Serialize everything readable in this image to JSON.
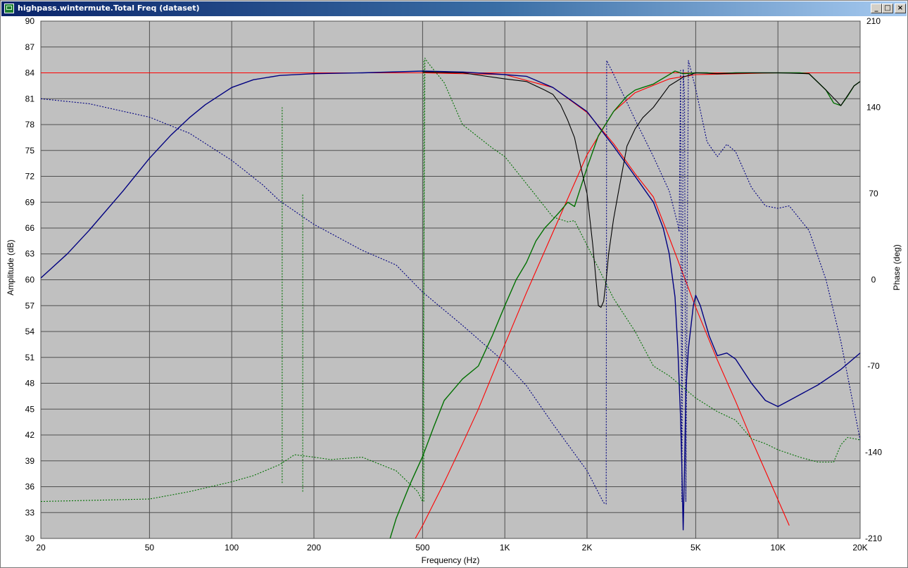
{
  "window": {
    "title": "highpass.wintermute.Total Freq (dataset)",
    "minimize_glyph": "_",
    "maximize_glyph": "□",
    "close_glyph": "×",
    "icon": "app-chart-icon"
  },
  "chart_data": {
    "type": "line",
    "xlabel": "Frequency (Hz)",
    "ylabel": "Amplitude (dB)",
    "y2label": "Phase (deg)",
    "xscale": "log",
    "xlim": [
      20,
      20000
    ],
    "ylim": [
      30,
      90
    ],
    "y2lim": [
      -210,
      210
    ],
    "grid": true,
    "x_ticks": [
      20,
      50,
      100,
      200,
      500,
      1000,
      2000,
      5000,
      10000,
      20000
    ],
    "x_tick_labels": [
      "20",
      "50",
      "100",
      "200",
      "500",
      "1K",
      "2K",
      "5K",
      "10K",
      "20K"
    ],
    "y_ticks": [
      30,
      33,
      36,
      39,
      42,
      45,
      48,
      51,
      54,
      57,
      60,
      63,
      66,
      69,
      72,
      75,
      78,
      81,
      84,
      87,
      90
    ],
    "y_tick_labels": [
      "30",
      "33",
      "36",
      "39",
      "42",
      "45",
      "48",
      "51",
      "54",
      "57",
      "60",
      "63",
      "66",
      "69",
      "72",
      "75",
      "78",
      "81",
      "84",
      "87",
      "90"
    ],
    "y2_ticks": [
      -210,
      -140,
      -70,
      0,
      70,
      140,
      210
    ],
    "y2_tick_labels": [
      "-210",
      "-140",
      "-70",
      "0",
      "70",
      "140",
      "210"
    ],
    "colors": {
      "plot_background": "#c0c0c0",
      "grid": "#505050",
      "target": "#ff0000",
      "woofer": "#000080",
      "tweeter": "#007000",
      "total": "#000000"
    },
    "series": [
      {
        "style": "red-solid",
        "color": "#ff0000",
        "axis": "left",
        "points": [
          [
            20,
            84
          ],
          [
            20000,
            84
          ]
        ]
      },
      {
        "style": "red-solid",
        "color": "#ff0000",
        "axis": "left",
        "points": [
          [
            20,
            84
          ],
          [
            500,
            84
          ],
          [
            1000,
            83.8
          ],
          [
            1500,
            82.3
          ],
          [
            2000,
            79.4
          ],
          [
            2500,
            75.8
          ],
          [
            3000,
            72.3
          ],
          [
            3500,
            69.6
          ],
          [
            4000,
            64.9
          ],
          [
            5000,
            56.8
          ],
          [
            6000,
            50.7
          ],
          [
            7000,
            45.9
          ],
          [
            8000,
            41.5
          ],
          [
            10000,
            34.5
          ],
          [
            11000,
            31.5
          ]
        ]
      },
      {
        "style": "red-solid",
        "color": "#ff0000",
        "axis": "left",
        "points": [
          [
            470,
            30
          ],
          [
            500,
            31.5
          ],
          [
            600,
            36.5
          ],
          [
            700,
            41
          ],
          [
            800,
            45
          ],
          [
            1000,
            52.5
          ],
          [
            1200,
            58.5
          ],
          [
            1500,
            65.5
          ],
          [
            2000,
            74.5
          ],
          [
            2500,
            79.5
          ],
          [
            3000,
            81.7
          ],
          [
            4000,
            83.3
          ],
          [
            5000,
            83.8
          ],
          [
            10000,
            84
          ],
          [
            20000,
            84
          ]
        ]
      },
      {
        "style": "navy-solid",
        "color": "#000080",
        "axis": "left",
        "points": [
          [
            20,
            60.2
          ],
          [
            25,
            63
          ],
          [
            30,
            65.7
          ],
          [
            40,
            70.3
          ],
          [
            50,
            74.1
          ],
          [
            60,
            76.8
          ],
          [
            70,
            78.8
          ],
          [
            80,
            80.3
          ],
          [
            100,
            82.3
          ],
          [
            120,
            83.2
          ],
          [
            150,
            83.7
          ],
          [
            200,
            83.9
          ],
          [
            300,
            84
          ],
          [
            500,
            84.2
          ],
          [
            700,
            84.1
          ],
          [
            1000,
            83.8
          ],
          [
            1200,
            83.6
          ],
          [
            1500,
            82.3
          ],
          [
            2000,
            79.5
          ],
          [
            2500,
            75.5
          ],
          [
            3000,
            72
          ],
          [
            3500,
            69
          ],
          [
            3800,
            66
          ],
          [
            4000,
            63
          ],
          [
            4200,
            58
          ],
          [
            4300,
            52
          ],
          [
            4400,
            44
          ],
          [
            4450,
            38
          ],
          [
            4500,
            31
          ],
          [
            4550,
            38
          ],
          [
            4600,
            47
          ],
          [
            4700,
            52
          ],
          [
            4900,
            57
          ],
          [
            5000,
            58.2
          ],
          [
            5200,
            57
          ],
          [
            5600,
            53.5
          ],
          [
            6000,
            51.2
          ],
          [
            6500,
            51.5
          ],
          [
            7000,
            50.8
          ],
          [
            8000,
            48
          ],
          [
            9000,
            46
          ],
          [
            10000,
            45.3
          ],
          [
            11000,
            46
          ],
          [
            14000,
            47.8
          ],
          [
            17000,
            49.6
          ],
          [
            20000,
            51.5
          ]
        ]
      },
      {
        "style": "navy-dotted",
        "color": "#000080",
        "axis": "right",
        "points": [
          [
            20,
            147
          ],
          [
            30,
            143
          ],
          [
            50,
            132
          ],
          [
            70,
            119
          ],
          [
            100,
            97
          ],
          [
            130,
            77
          ],
          [
            150,
            64
          ],
          [
            200,
            45
          ],
          [
            300,
            24
          ],
          [
            400,
            12
          ],
          [
            500,
            -10
          ],
          [
            700,
            -37
          ],
          [
            1000,
            -67
          ],
          [
            1200,
            -86
          ],
          [
            1500,
            -117
          ],
          [
            2000,
            -155
          ],
          [
            2300,
            -181
          ],
          [
            2350,
            -182
          ],
          [
            2360,
            178
          ],
          [
            2500,
            167
          ],
          [
            3000,
            130
          ],
          [
            3500,
            100
          ],
          [
            4000,
            72
          ],
          [
            4300,
            45
          ],
          [
            4350,
            39
          ],
          [
            4400,
            170
          ],
          [
            4450,
            -180
          ],
          [
            4500,
            171
          ],
          [
            4550,
            150
          ],
          [
            4600,
            -180
          ],
          [
            4700,
            178
          ],
          [
            5000,
            155
          ],
          [
            5500,
            112
          ],
          [
            6000,
            100
          ],
          [
            6500,
            110
          ],
          [
            7000,
            104
          ],
          [
            8000,
            75
          ],
          [
            9000,
            60
          ],
          [
            10000,
            58
          ],
          [
            11000,
            60
          ],
          [
            13000,
            40
          ],
          [
            15000,
            0
          ],
          [
            17000,
            -50
          ],
          [
            20000,
            -130
          ]
        ]
      },
      {
        "style": "green-solid",
        "color": "#007000",
        "axis": "left",
        "points": [
          [
            380,
            30
          ],
          [
            400,
            32.3
          ],
          [
            450,
            36.3
          ],
          [
            500,
            39.5
          ],
          [
            550,
            43
          ],
          [
            600,
            46
          ],
          [
            700,
            48.5
          ],
          [
            800,
            50
          ],
          [
            900,
            53.5
          ],
          [
            1000,
            57
          ],
          [
            1100,
            60
          ],
          [
            1200,
            62
          ],
          [
            1300,
            64.5
          ],
          [
            1400,
            66
          ],
          [
            1500,
            67
          ],
          [
            1600,
            68
          ],
          [
            1700,
            69
          ],
          [
            1800,
            68.5
          ],
          [
            2000,
            73
          ],
          [
            2200,
            76.7
          ],
          [
            2500,
            79.5
          ],
          [
            2800,
            81.3
          ],
          [
            3000,
            82
          ],
          [
            3200,
            82.3
          ],
          [
            3500,
            82.7
          ],
          [
            4000,
            83.8
          ],
          [
            4200,
            84.2
          ],
          [
            4500,
            83.9
          ],
          [
            5000,
            84
          ],
          [
            5500,
            84
          ],
          [
            6000,
            83.9
          ],
          [
            7000,
            84
          ],
          [
            8000,
            84
          ],
          [
            10000,
            84
          ],
          [
            12000,
            84
          ],
          [
            13000,
            83.9
          ],
          [
            15000,
            82
          ],
          [
            16000,
            80.5
          ],
          [
            17000,
            80.2
          ],
          [
            18000,
            81.3
          ],
          [
            19000,
            82.5
          ],
          [
            20000,
            83
          ]
        ]
      },
      {
        "style": "green-dotted",
        "color": "#007000",
        "axis": "right",
        "points": [
          [
            20,
            -180
          ],
          [
            50,
            -178
          ],
          [
            70,
            -172
          ],
          [
            100,
            -164
          ],
          [
            120,
            -159
          ],
          [
            150,
            -150
          ],
          [
            170,
            -142
          ],
          [
            200,
            -144
          ],
          [
            230,
            -146
          ],
          [
            300,
            -144
          ],
          [
            400,
            -155
          ],
          [
            480,
            -172
          ],
          [
            500,
            -180
          ],
          [
            510,
            180
          ],
          [
            520,
            177
          ],
          [
            600,
            160
          ],
          [
            700,
            126
          ],
          [
            900,
            107
          ],
          [
            1000,
            100
          ],
          [
            1200,
            78
          ],
          [
            1500,
            51
          ],
          [
            1700,
            47
          ],
          [
            1800,
            48
          ],
          [
            2000,
            28
          ],
          [
            2500,
            -15
          ],
          [
            3000,
            -42
          ],
          [
            3500,
            -70
          ],
          [
            4000,
            -78
          ],
          [
            5000,
            -96
          ],
          [
            6000,
            -107
          ],
          [
            7000,
            -114
          ],
          [
            8000,
            -129
          ],
          [
            9000,
            -133
          ],
          [
            10000,
            -138
          ],
          [
            12000,
            -144
          ],
          [
            14000,
            -148
          ],
          [
            16000,
            -148
          ],
          [
            17000,
            -134
          ],
          [
            18000,
            -128
          ],
          [
            20000,
            -130
          ]
        ]
      },
      {
        "style": "black-solid",
        "color": "#000000",
        "axis": "left",
        "points": [
          [
            500,
            84.1
          ],
          [
            700,
            84
          ],
          [
            1000,
            83.3
          ],
          [
            1200,
            83
          ],
          [
            1400,
            82
          ],
          [
            1500,
            81.5
          ],
          [
            1600,
            80.3
          ],
          [
            1700,
            78.5
          ],
          [
            1800,
            76.5
          ],
          [
            1900,
            73
          ],
          [
            2000,
            70
          ],
          [
            2100,
            64
          ],
          [
            2200,
            57
          ],
          [
            2250,
            56.8
          ],
          [
            2300,
            57.5
          ],
          [
            2350,
            60
          ],
          [
            2400,
            63
          ],
          [
            2500,
            67
          ],
          [
            2600,
            70
          ],
          [
            2800,
            75.5
          ],
          [
            3000,
            77.5
          ],
          [
            3200,
            78.8
          ],
          [
            3500,
            80
          ],
          [
            4000,
            82.5
          ],
          [
            4500,
            83.5
          ],
          [
            5000,
            84
          ],
          [
            6000,
            83.9
          ],
          [
            8000,
            84
          ],
          [
            10000,
            84
          ],
          [
            13000,
            83.9
          ],
          [
            15000,
            82
          ],
          [
            17000,
            80.2
          ],
          [
            19000,
            82.5
          ],
          [
            20000,
            83
          ]
        ]
      },
      {
        "style": "green-spike",
        "color": "#007000",
        "axis": "right",
        "points": [
          [
            153,
            -165
          ],
          [
            153,
            140
          ]
        ]
      },
      {
        "style": "green-spike",
        "color": "#007000",
        "axis": "right",
        "points": [
          [
            182,
            -172
          ],
          [
            182,
            70
          ]
        ]
      },
      {
        "style": "green-spike",
        "color": "#007000",
        "axis": "right",
        "points": [
          [
            505,
            -180
          ],
          [
            505,
            179
          ]
        ]
      }
    ]
  }
}
